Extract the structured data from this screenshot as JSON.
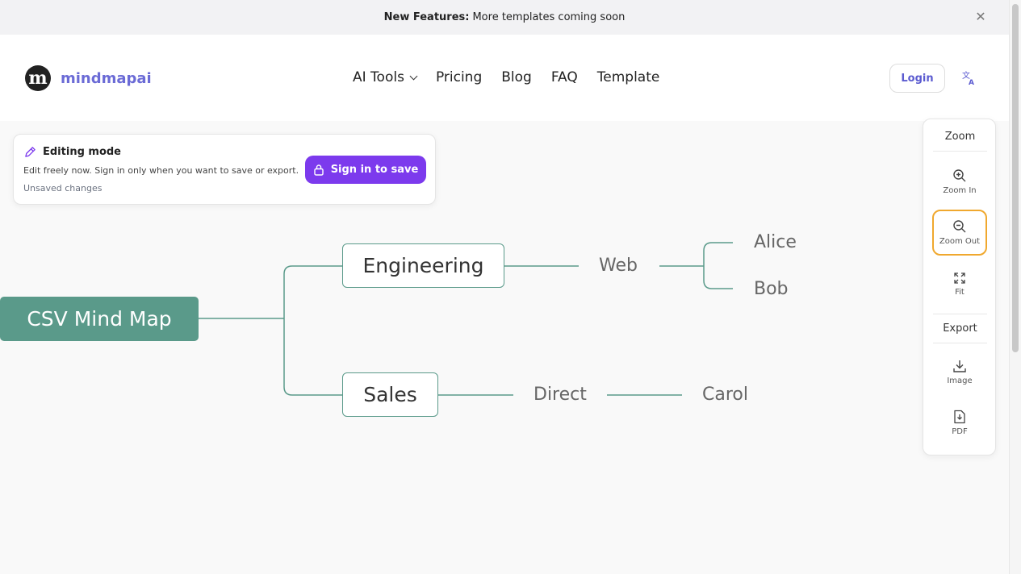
{
  "banner": {
    "strong": "New Features:",
    "text": "More templates coming soon"
  },
  "header": {
    "logo_letter": "m",
    "logo_text": "mindmapai",
    "nav": [
      "AI Tools",
      "Pricing",
      "Blog",
      "FAQ",
      "Template"
    ],
    "login_label": "Login"
  },
  "editing": {
    "title": "Editing mode",
    "description": "Edit freely now. Sign in only when you want to save or export.",
    "status": "Unsaved changes",
    "signin_label": "Sign in to save"
  },
  "mindmap": {
    "root": "CSV Mind Map",
    "engineering": "Engineering",
    "web": "Web",
    "alice": "Alice",
    "bob": "Bob",
    "sales": "Sales",
    "direct": "Direct",
    "carol": "Carol"
  },
  "zoom_panel": {
    "zoom_title": "Zoom",
    "zoom_in": "Zoom In",
    "zoom_out": "Zoom Out",
    "fit": "Fit",
    "export_title": "Export",
    "image": "Image",
    "pdf": "PDF"
  },
  "colors": {
    "accent": "#7c3aed",
    "node": "#5a9a8a",
    "brand": "#6b6bd6",
    "active_outline": "#f0a82e"
  }
}
